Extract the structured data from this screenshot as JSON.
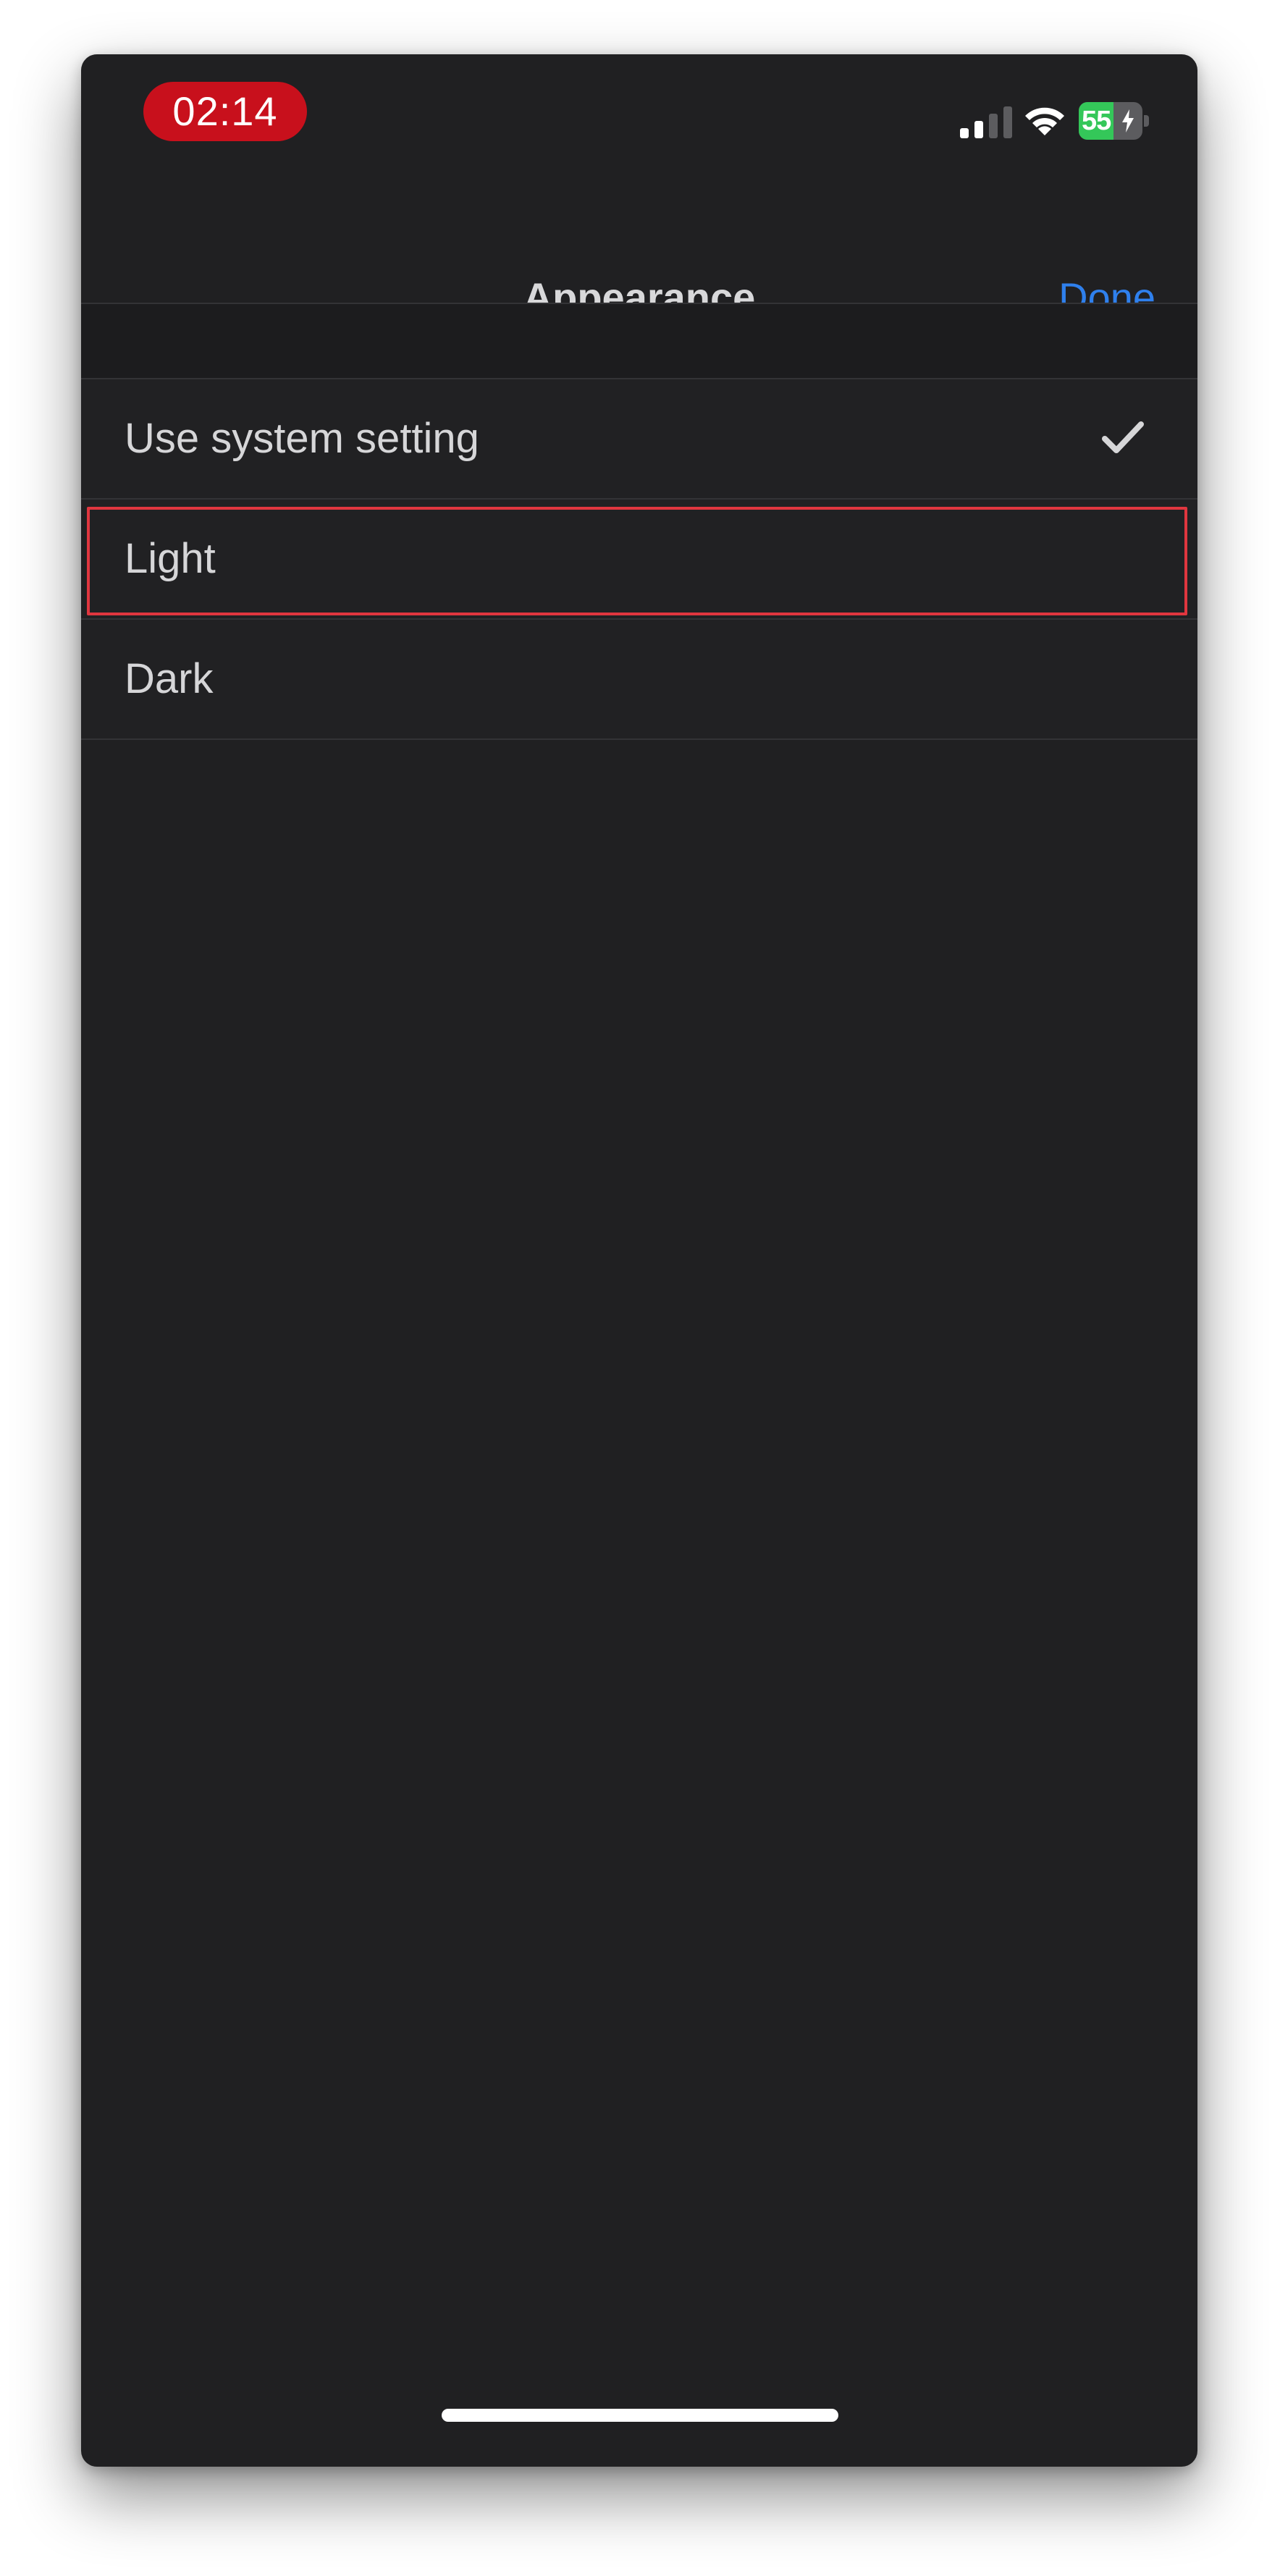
{
  "status_bar": {
    "time": "02:14",
    "battery_level": "55",
    "battery_fraction": 0.55,
    "time_pill_color": "#c8101c",
    "battery_color": "#34c759"
  },
  "nav": {
    "title": "Appearance",
    "done_label": "Done",
    "accent_color": "#2f80ed"
  },
  "options": [
    {
      "label": "Use system setting",
      "selected": true
    },
    {
      "label": "Light",
      "selected": false,
      "highlighted": true
    },
    {
      "label": "Dark",
      "selected": false
    }
  ],
  "icons": {
    "signal": "cellular-signal-icon",
    "wifi": "wifi-icon",
    "battery": "battery-charging-icon",
    "checkmark": "checkmark-icon"
  }
}
